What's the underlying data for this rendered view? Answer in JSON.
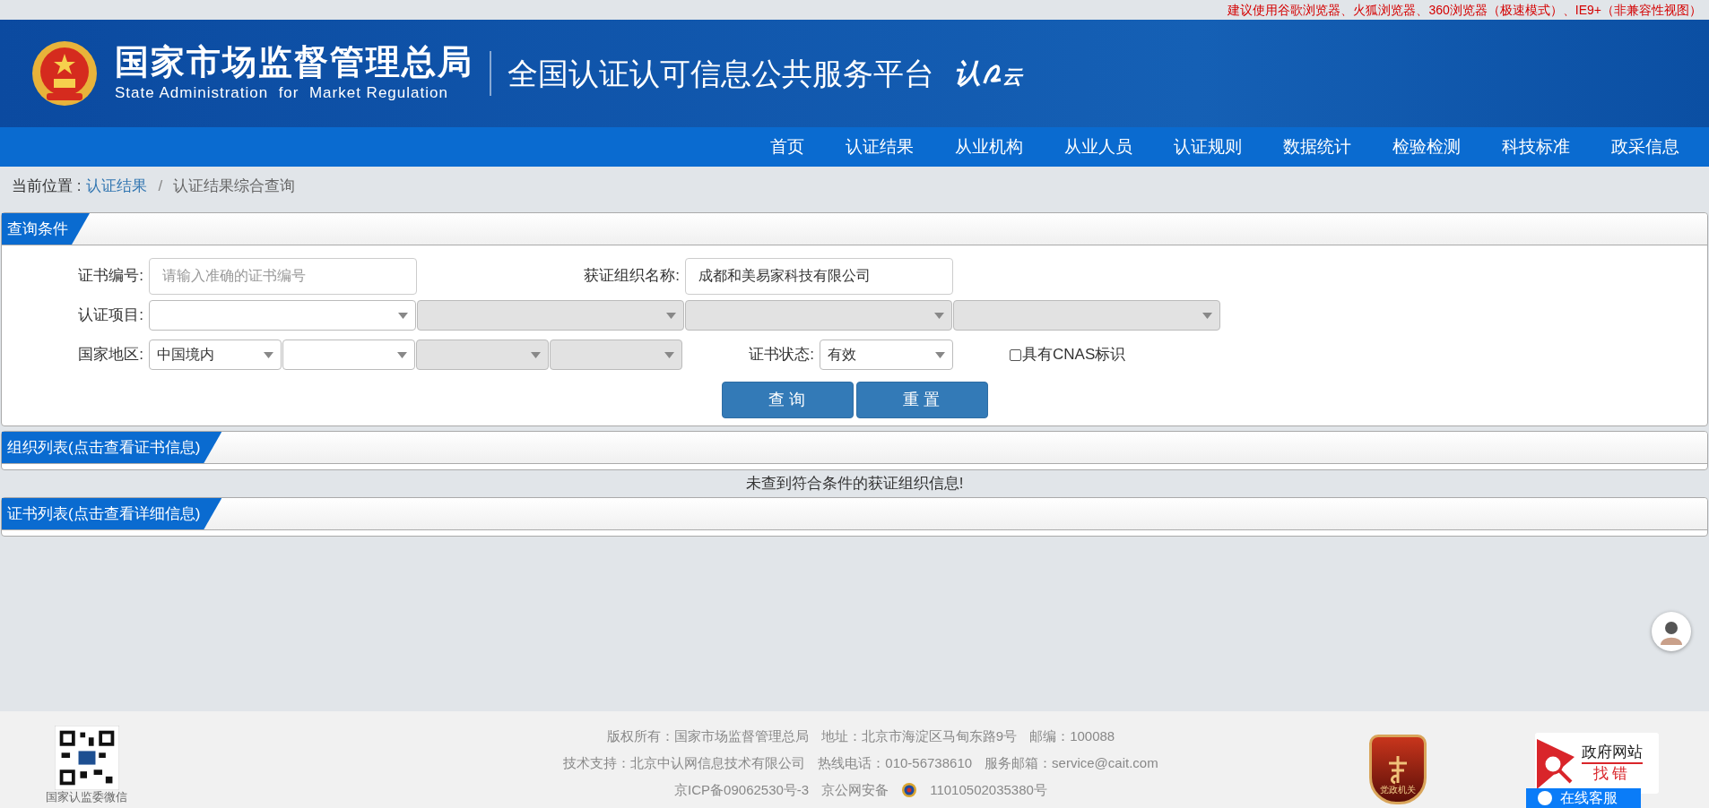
{
  "top_notice": "建议使用谷歌浏览器、火狐浏览器、360浏览器（极速模式）、IE9+（非兼容性视图）",
  "header": {
    "agency_cn": "国家市场监督管理总局",
    "agency_en": "State Administration  for  Market Regulation",
    "platform": "全国认证认可信息公共服务平台",
    "platform_logo": [
      "认",
      "云"
    ]
  },
  "nav": [
    {
      "label": "首页",
      "selected": false
    },
    {
      "label": "认证结果",
      "selected": false
    },
    {
      "label": "从业机构",
      "selected": false
    },
    {
      "label": "从业人员",
      "selected": false
    },
    {
      "label": "认证规则",
      "selected": false
    },
    {
      "label": "数据统计",
      "selected": false
    },
    {
      "label": "检验检测",
      "selected": false
    },
    {
      "label": "科技标准",
      "selected": false
    },
    {
      "label": "政采信息",
      "selected": false
    }
  ],
  "breadcrumb": {
    "prefix": "当前位置 :",
    "link": "认证结果",
    "separator": "/",
    "current": "认证结果综合查询"
  },
  "query_panel": {
    "title": "查询条件",
    "cert_no": {
      "label": "证书编号:",
      "placeholder": "请输入准确的证书编号"
    },
    "org_name": {
      "label": "获证组织名称:",
      "value": "成都和美易家科技有限公司"
    },
    "project": {
      "label": "认证项目:",
      "selects": [
        {
          "disabled": false
        },
        {
          "disabled": true
        },
        {
          "disabled": true
        },
        {
          "disabled": true
        }
      ]
    },
    "region": {
      "label": "国家地区:",
      "selects": [
        {
          "value": "中国境内",
          "disabled": false
        },
        {
          "disabled": false
        },
        {
          "disabled": true
        },
        {
          "disabled": true
        }
      ]
    },
    "status": {
      "label": "证书状态:",
      "value": "有效"
    },
    "cnas": {
      "label": "具有CNAS标识",
      "checked": false
    },
    "buttons": [
      "查 询",
      "重 置"
    ]
  },
  "org_list": {
    "title": "组织列表(点击查看证书信息)",
    "message": "未查到符合条件的获证组织信息!"
  },
  "cert_list": {
    "title": "证书列表(点击查看详细信息)"
  },
  "footer": {
    "qr_caption": "国家认监委微信",
    "lines": [
      [
        "版权所有：国家市场监督管理总局",
        "地址：北京市海淀区马甸东路9号",
        "邮编：100088"
      ],
      [
        "技术支持：北京中认网信息技术有限公司",
        "热线电话：010-56738610",
        "服务邮箱：service@cait.com"
      ],
      [
        "京ICP备09062530号-3",
        "京公网安备",
        "11010502035380号"
      ]
    ],
    "party_badge": "党政机关",
    "error_badge": [
      "政府网站",
      "找错"
    ],
    "chat_button": "在线客服"
  }
}
